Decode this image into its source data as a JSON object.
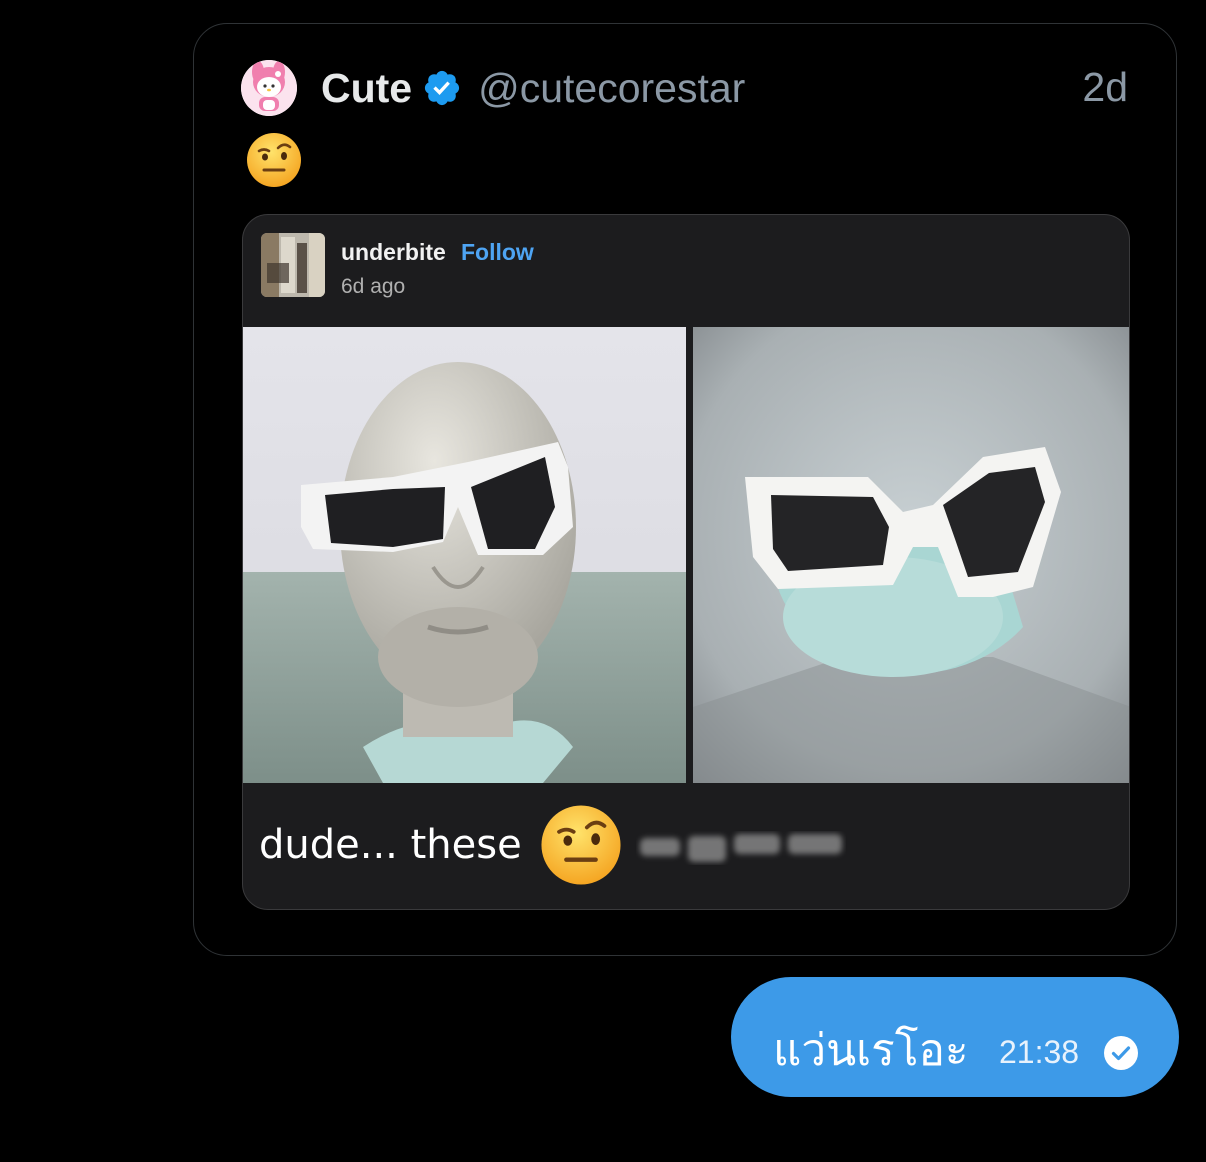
{
  "tweet": {
    "display_name": "Cute",
    "handle": "@cutecorestar",
    "time_ago": "2d",
    "icons": [
      "avatar-melody-icon",
      "verified-badge-icon",
      "raised-eyebrow-emoji-icon"
    ]
  },
  "embedded_post": {
    "username": "underbite",
    "follow_label": "Follow",
    "time": "6d ago",
    "caption": "dude... these",
    "colors": {
      "follow": "#4ea4f3",
      "card_bg": "#1c1c1e"
    }
  },
  "message": {
    "text": "แว่นเรโอะ",
    "time": "21:38",
    "bubble_color": "#3d9ae8",
    "status_icon": "check-circle-icon"
  }
}
